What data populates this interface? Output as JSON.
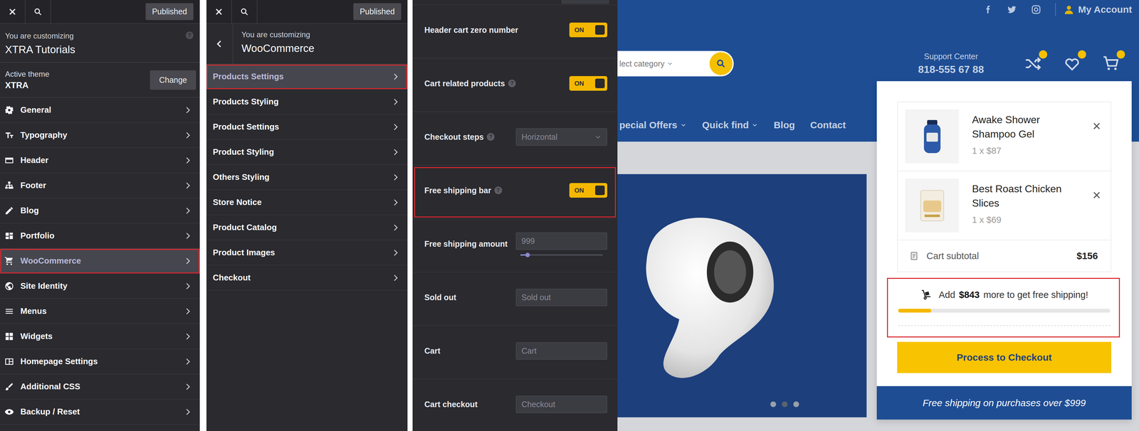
{
  "customizer": {
    "published_label": "Published",
    "help_glyph": "?",
    "caption": "You are customizing",
    "title": "XTRA Tutorials",
    "active_theme": {
      "label": "Active theme",
      "name": "XTRA",
      "button": "Change"
    },
    "menu": [
      {
        "label": "General",
        "selected": false
      },
      {
        "label": "Typography",
        "selected": false
      },
      {
        "label": "Header",
        "selected": false
      },
      {
        "label": "Footer",
        "selected": false
      },
      {
        "label": "Blog",
        "selected": false
      },
      {
        "label": "Portfolio",
        "selected": false
      },
      {
        "label": "WooCommerce",
        "selected": true
      },
      {
        "label": "Site Identity",
        "selected": false
      },
      {
        "label": "Menus",
        "selected": false
      },
      {
        "label": "Widgets",
        "selected": false
      },
      {
        "label": "Homepage Settings",
        "selected": false
      },
      {
        "label": "Additional CSS",
        "selected": false
      },
      {
        "label": "Backup / Reset",
        "selected": false
      }
    ]
  },
  "woocommerce": {
    "published_label": "Published",
    "caption": "You are customizing",
    "title": "WooCommerce",
    "items": [
      {
        "label": "Products Settings",
        "selected": true
      },
      {
        "label": "Products Styling",
        "selected": false
      },
      {
        "label": "Product Settings",
        "selected": false
      },
      {
        "label": "Product Styling",
        "selected": false
      },
      {
        "label": "Others Styling",
        "selected": false
      },
      {
        "label": "Store Notice",
        "selected": false
      },
      {
        "label": "Product Catalog",
        "selected": false
      },
      {
        "label": "Product Images",
        "selected": false
      },
      {
        "label": "Checkout",
        "selected": false
      }
    ]
  },
  "settings": {
    "help_glyph": "?",
    "rows": [
      {
        "kind": "toggle",
        "label": "Header cart zero number",
        "help": false,
        "on": true,
        "state_label": "ON",
        "highlighted": false
      },
      {
        "kind": "toggle",
        "label": "Cart related products",
        "help": true,
        "on": true,
        "state_label": "ON",
        "highlighted": false
      },
      {
        "kind": "select",
        "label": "Checkout steps",
        "help": true,
        "value": "Horizontal",
        "highlighted": false
      },
      {
        "kind": "toggle",
        "label": "Free shipping bar",
        "help": true,
        "on": true,
        "state_label": "ON",
        "highlighted": true
      },
      {
        "kind": "range",
        "label": "Free shipping amount",
        "help": false,
        "placeholder": "999",
        "level": 0.09,
        "highlighted": false
      },
      {
        "kind": "text",
        "label": "Sold out",
        "help": false,
        "placeholder": "Sold out",
        "highlighted": false
      },
      {
        "kind": "text",
        "label": "Cart",
        "help": false,
        "placeholder": "Cart",
        "highlighted": false
      },
      {
        "kind": "text",
        "label": "Cart checkout",
        "help": false,
        "placeholder": "Checkout",
        "highlighted": false
      }
    ]
  },
  "site": {
    "account": "My Account",
    "search_placeholder": "lect category",
    "support": {
      "label": "Support Center",
      "phone": "818-555 67 88"
    },
    "header_icons": [
      {
        "badge": true
      },
      {
        "badge": true
      },
      {
        "badge": true
      }
    ],
    "nav": [
      {
        "label": "pecial Offers",
        "dropdown": true
      },
      {
        "label": "Quick find",
        "dropdown": true
      },
      {
        "label": "Blog",
        "dropdown": false
      },
      {
        "label": "Contact",
        "dropdown": false
      }
    ],
    "slider_dots": [
      {
        "selected": false
      },
      {
        "selected": true
      },
      {
        "selected": false
      }
    ],
    "cart": {
      "items": [
        {
          "name": "Awake Shower Shampoo Gel",
          "price": "1 x $87"
        },
        {
          "name": "Best Roast Chicken Slices",
          "price": "1 x $69"
        }
      ],
      "remove_glyph": "×",
      "subtotal_label": "Cart subtotal",
      "subtotal": "$156",
      "shipping": {
        "prefix": "Add",
        "amount": "$843",
        "suffix": "more to get free shipping!",
        "level": 0.156,
        "highlighted": true
      },
      "checkout": "Process to Checkout",
      "notice": "Free shipping on purchases over $999"
    }
  }
}
